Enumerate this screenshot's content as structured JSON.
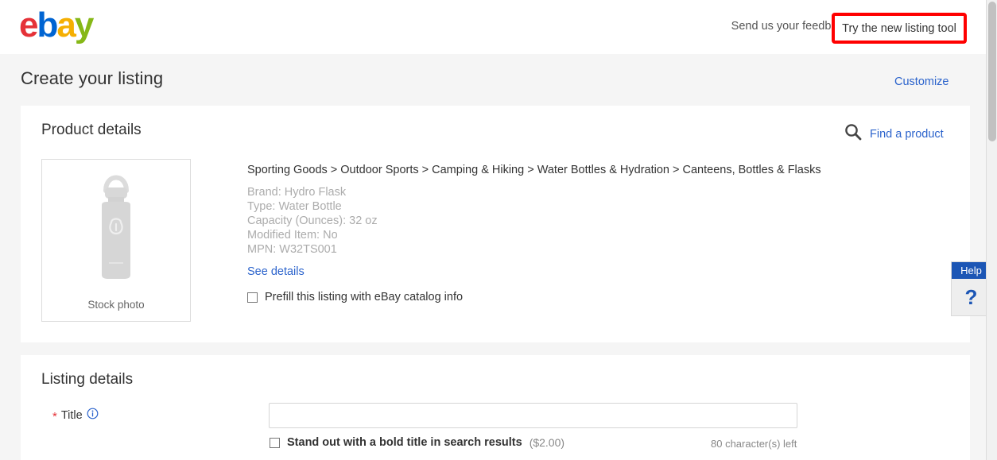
{
  "header": {
    "logo_text": "ebay",
    "logo_letters": [
      "e",
      "b",
      "a",
      "y"
    ],
    "feedback_label": "Send us your feedback",
    "new_tool_label": "Try the new listing tool",
    "highlight_color": "#ff0000"
  },
  "page": {
    "title": "Create your listing",
    "customize_label": "Customize"
  },
  "product_details": {
    "section_title": "Product details",
    "find_product_label": "Find a product",
    "find_product_icon": "search-icon",
    "stock_photo_caption": "Stock photo",
    "breadcrumb": "Sporting Goods > Outdoor Sports > Camping & Hiking > Water Bottles & Hydration > Canteens, Bottles & Flasks",
    "attributes": [
      "Brand: Hydro Flask",
      "Type: Water Bottle",
      "Capacity (Ounces): 32 oz",
      "Modified Item: No",
      "MPN: W32TS001"
    ],
    "see_details_label": "See details",
    "prefill_label": "Prefill this listing with eBay catalog info",
    "prefill_checked": false
  },
  "listing_details": {
    "section_title": "Listing details",
    "title_field": {
      "required_marker": "*",
      "label": "Title",
      "info_icon": "info-circle-icon",
      "value": "",
      "placeholder": ""
    },
    "bold_title": {
      "label": "Stand out with a bold title in search results",
      "price": "($2.00)",
      "checked": false
    },
    "characters_left": "80 character(s) left"
  },
  "help": {
    "header_label": "Help",
    "question_mark": "?",
    "accent_color": "#1c56b5"
  }
}
